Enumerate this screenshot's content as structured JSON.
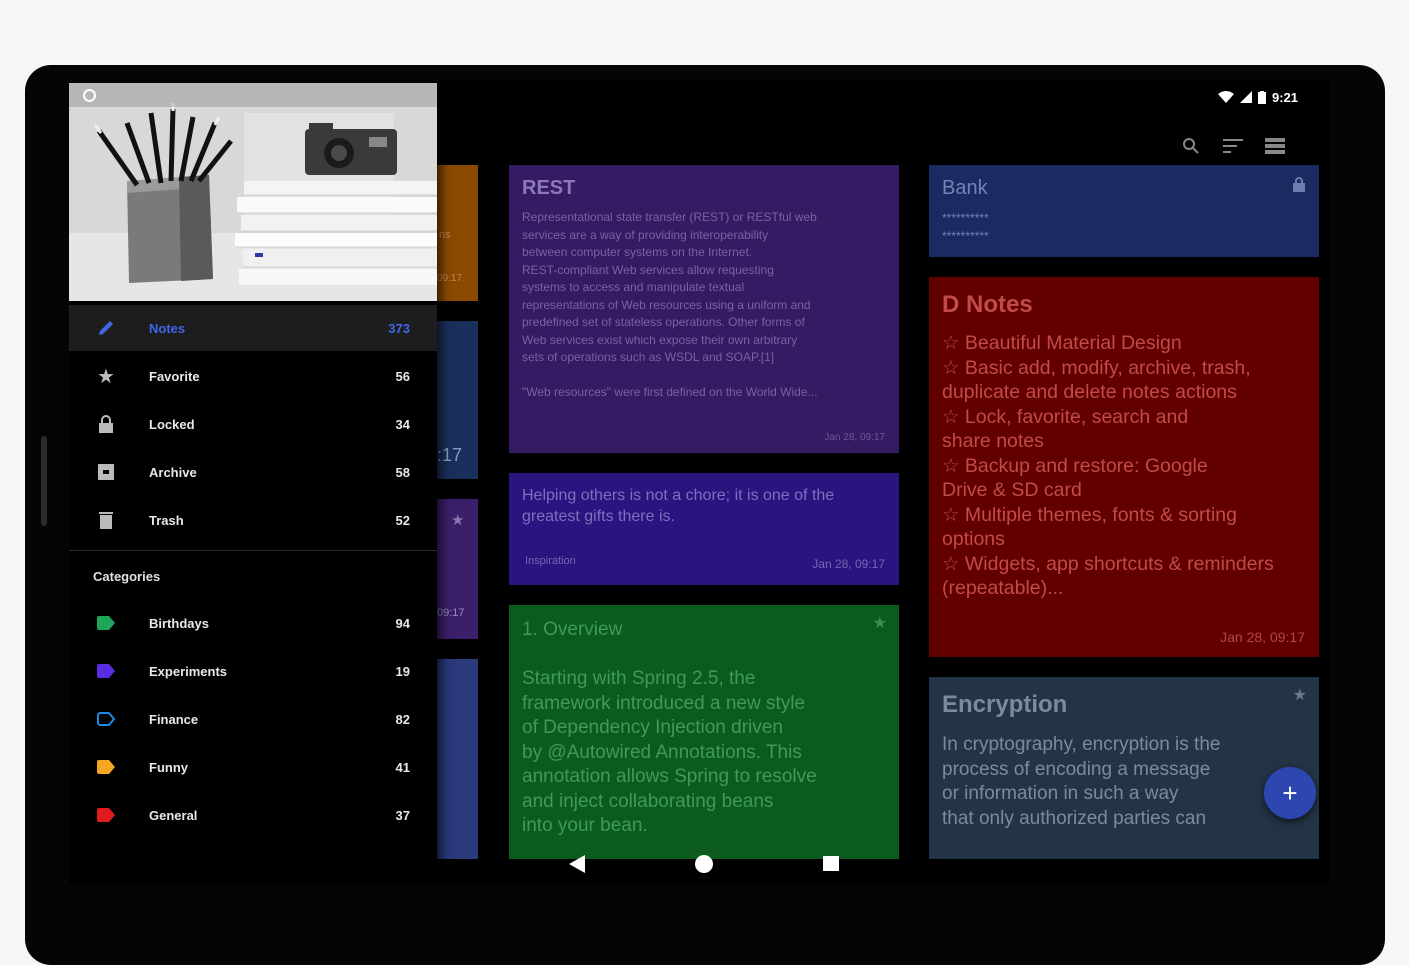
{
  "status_bar": {
    "time": "9:21"
  },
  "toolbar": {
    "search_icon": "search-icon",
    "sort_icon": "sort-icon",
    "view_icon": "view-toggle-icon"
  },
  "peek_cards": [
    {
      "fragment_1": "ns",
      "fragment_2": "09:17",
      "color": "#8a4a00"
    },
    {
      "fragment_1": ":17",
      "color": "#1b2f5c"
    },
    {
      "fragment_1": "09:17",
      "color": "#3c1f6a"
    },
    {
      "color": "#2a3a7a"
    }
  ],
  "notes": {
    "rest": {
      "title": "REST",
      "body": "Representational state transfer (REST) or RESTful web\nservices are a way of providing interoperability\nbetween computer systems on the Internet.\nREST-compliant Web services allow requesting\nsystems to access and manipulate textual\nrepresentations of Web resources using a uniform and\npredefined set of stateless operations. Other forms of\nWeb services exist which expose their own arbitrary\nsets of operations such as WSDL and SOAP.[1]\n\n\"Web resources\" were first defined on the World Wide...",
      "date": "Jan 28, 09:17",
      "color": "#361a63"
    },
    "quote": {
      "body": "Helping others is not a chore; it is one of the\ngreatest gifts there is.",
      "label": "Inspiration",
      "date": "Jan 28, 09:17",
      "color": "#2a1480"
    },
    "overview": {
      "title": "1. Overview",
      "body": "Starting with Spring 2.5, the\nframework introduced a new style\nof Dependency Injection driven\nby @Autowired Annotations. This\nannotation allows Spring to resolve\nand inject collaborating beans\ninto your bean.",
      "star": "★",
      "color": "#0b5a20"
    },
    "bank": {
      "title": "Bank",
      "body": "**********\n**********",
      "color": "#1b2a60"
    },
    "dnotes": {
      "title": "D Notes",
      "body": "☆ Beautiful Material Design\n☆ Basic add, modify, archive, trash,\nduplicate and delete notes actions\n☆ Lock, favorite, search and\nshare notes\n☆ Backup and restore: Google\nDrive & SD card\n☆ Multiple themes, fonts & sorting\noptions\n☆ Widgets, app shortcuts & reminders\n(repeatable)...",
      "date": "Jan 28, 09:17",
      "color": "#620000"
    },
    "encryption": {
      "title": "Encryption",
      "body": "In cryptography, encryption is the\nprocess of encoding a message\nor information in such a way\nthat only authorized parties can",
      "star": "★",
      "color": "#243447"
    }
  },
  "drawer": {
    "items": [
      {
        "label": "Notes",
        "count": "373",
        "icon": "pencil-icon"
      },
      {
        "label": "Favorite",
        "count": "56",
        "icon": "star-icon"
      },
      {
        "label": "Locked",
        "count": "34",
        "icon": "lock-icon"
      },
      {
        "label": "Archive",
        "count": "58",
        "icon": "archive-icon"
      },
      {
        "label": "Trash",
        "count": "52",
        "icon": "trash-icon"
      }
    ],
    "categories_title": "Categories",
    "categories": [
      {
        "label": "Birthdays",
        "count": "94",
        "color": "#1fa55a"
      },
      {
        "label": "Experiments",
        "count": "19",
        "color": "#5b2ce0"
      },
      {
        "label": "Finance",
        "count": "82",
        "color": "#1e88e5"
      },
      {
        "label": "Funny",
        "count": "41",
        "color": "#f5a623"
      },
      {
        "label": "General",
        "count": "37",
        "color": "#e01b1b"
      }
    ]
  },
  "fab": {
    "label": "+"
  }
}
